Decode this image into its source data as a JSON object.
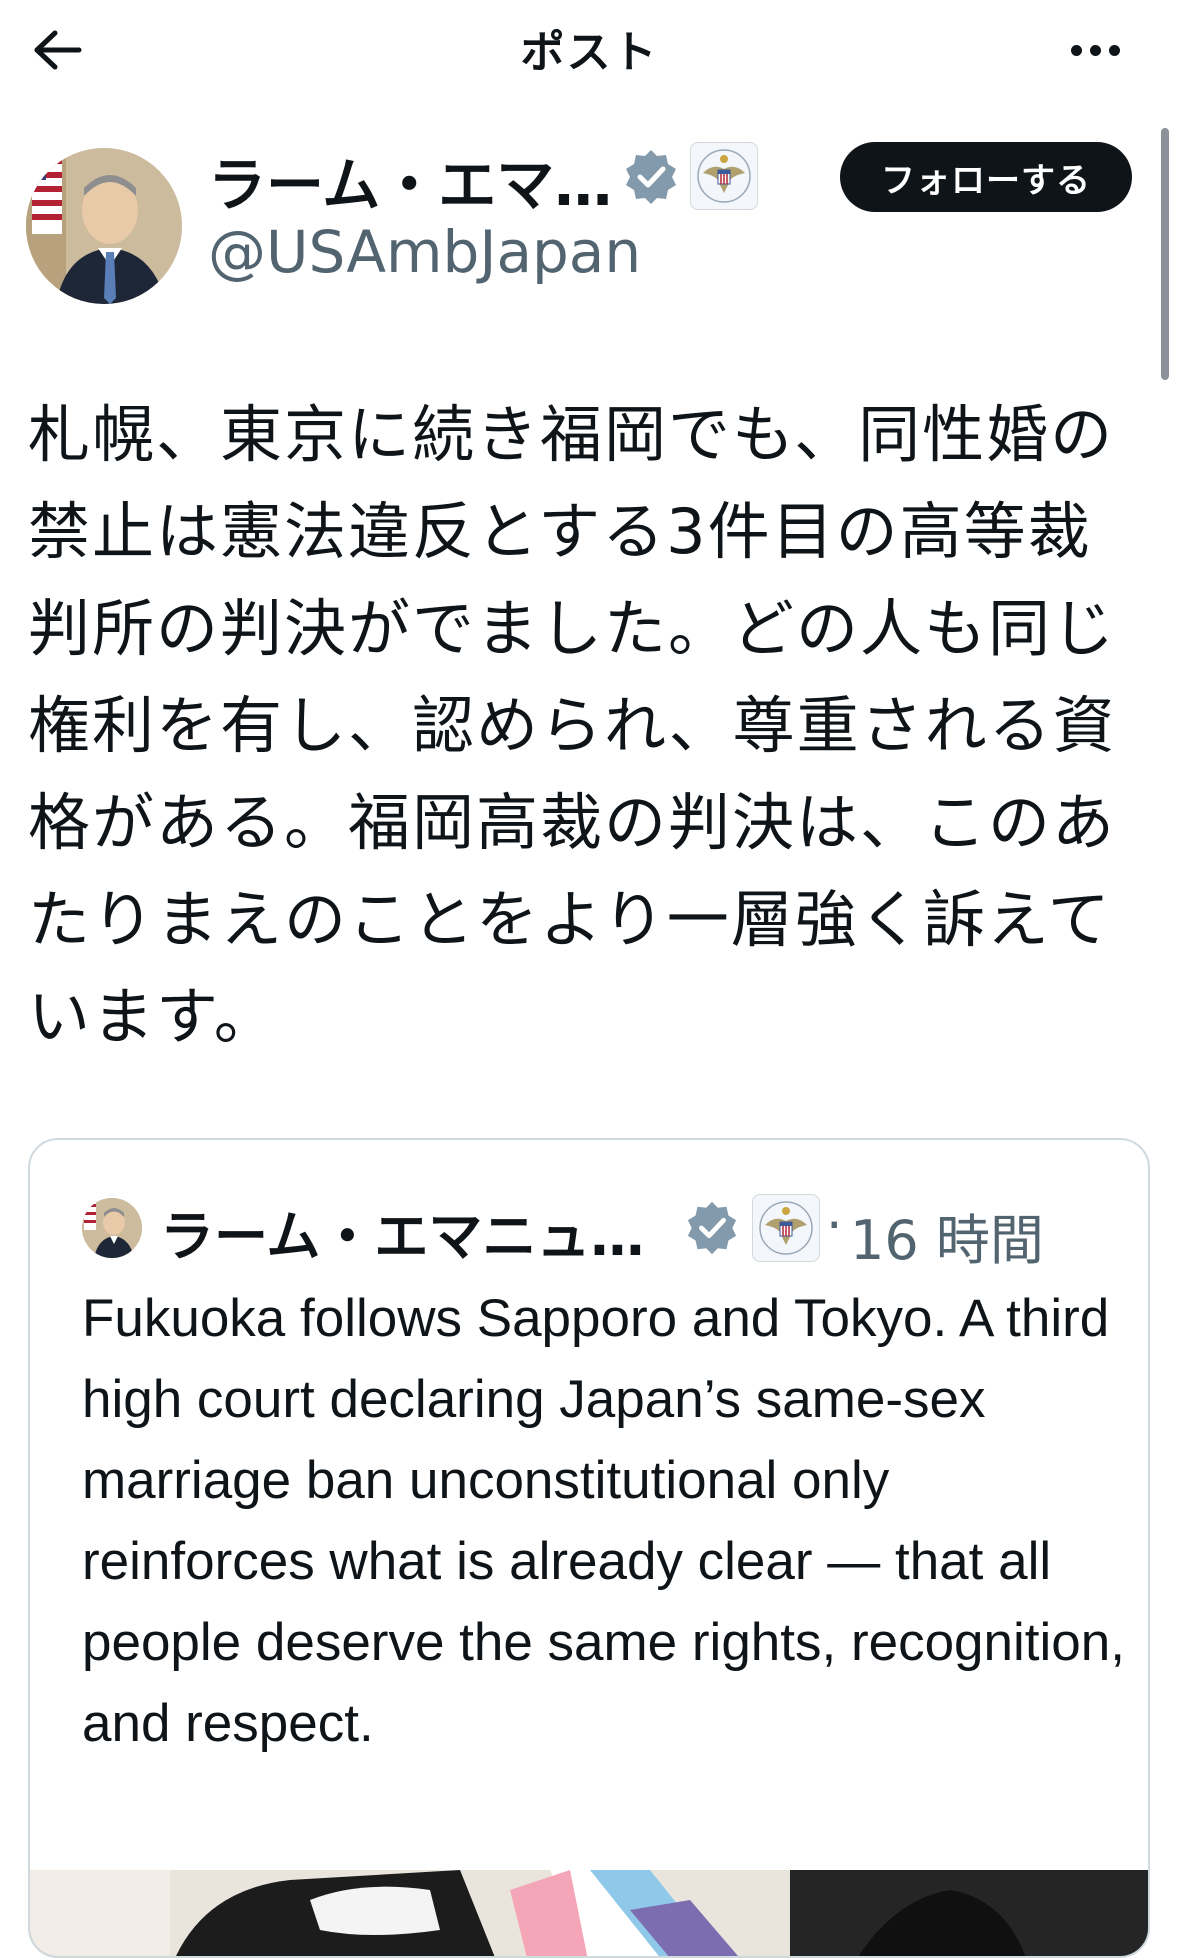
{
  "header": {
    "title": "ポスト",
    "back_icon": "arrow-left-icon",
    "more_icon": "more-horizontal-icon"
  },
  "author": {
    "name": "ラーム・エマ…",
    "handle": "@USAmbJapan",
    "verified_icon": "verified-badge-icon",
    "affiliation_icon": "us-embassy-seal-icon"
  },
  "follow_button": {
    "label": "フォローする"
  },
  "post": {
    "text": "札幌、東京に続き福岡でも、同性婚の\n禁止は憲法違反とする3件目の高等裁\n判所の判決がでました。どの人も同じ\n権利を有し、認められ、尊重される資\n格がある。福岡高裁の判決は、このあ\nたりまえのことをより一層強く訴えて\nいます。"
  },
  "quoted_post": {
    "name": "ラーム・エマニュ…",
    "separator": "·",
    "time": "16 時間",
    "text": "Fukuoka follows Sapporo and Tokyo. A third high court declaring Japan’s same-sex marriage ban unconstitutional only reinforces what is already clear — that all people deserve the same rights, recognition, and respect."
  },
  "colors": {
    "text_primary": "#0f1419",
    "text_secondary": "#536471",
    "follow_button_bg": "#0f1419",
    "verified_blue": "#829aab",
    "border": "#cfd9de"
  }
}
